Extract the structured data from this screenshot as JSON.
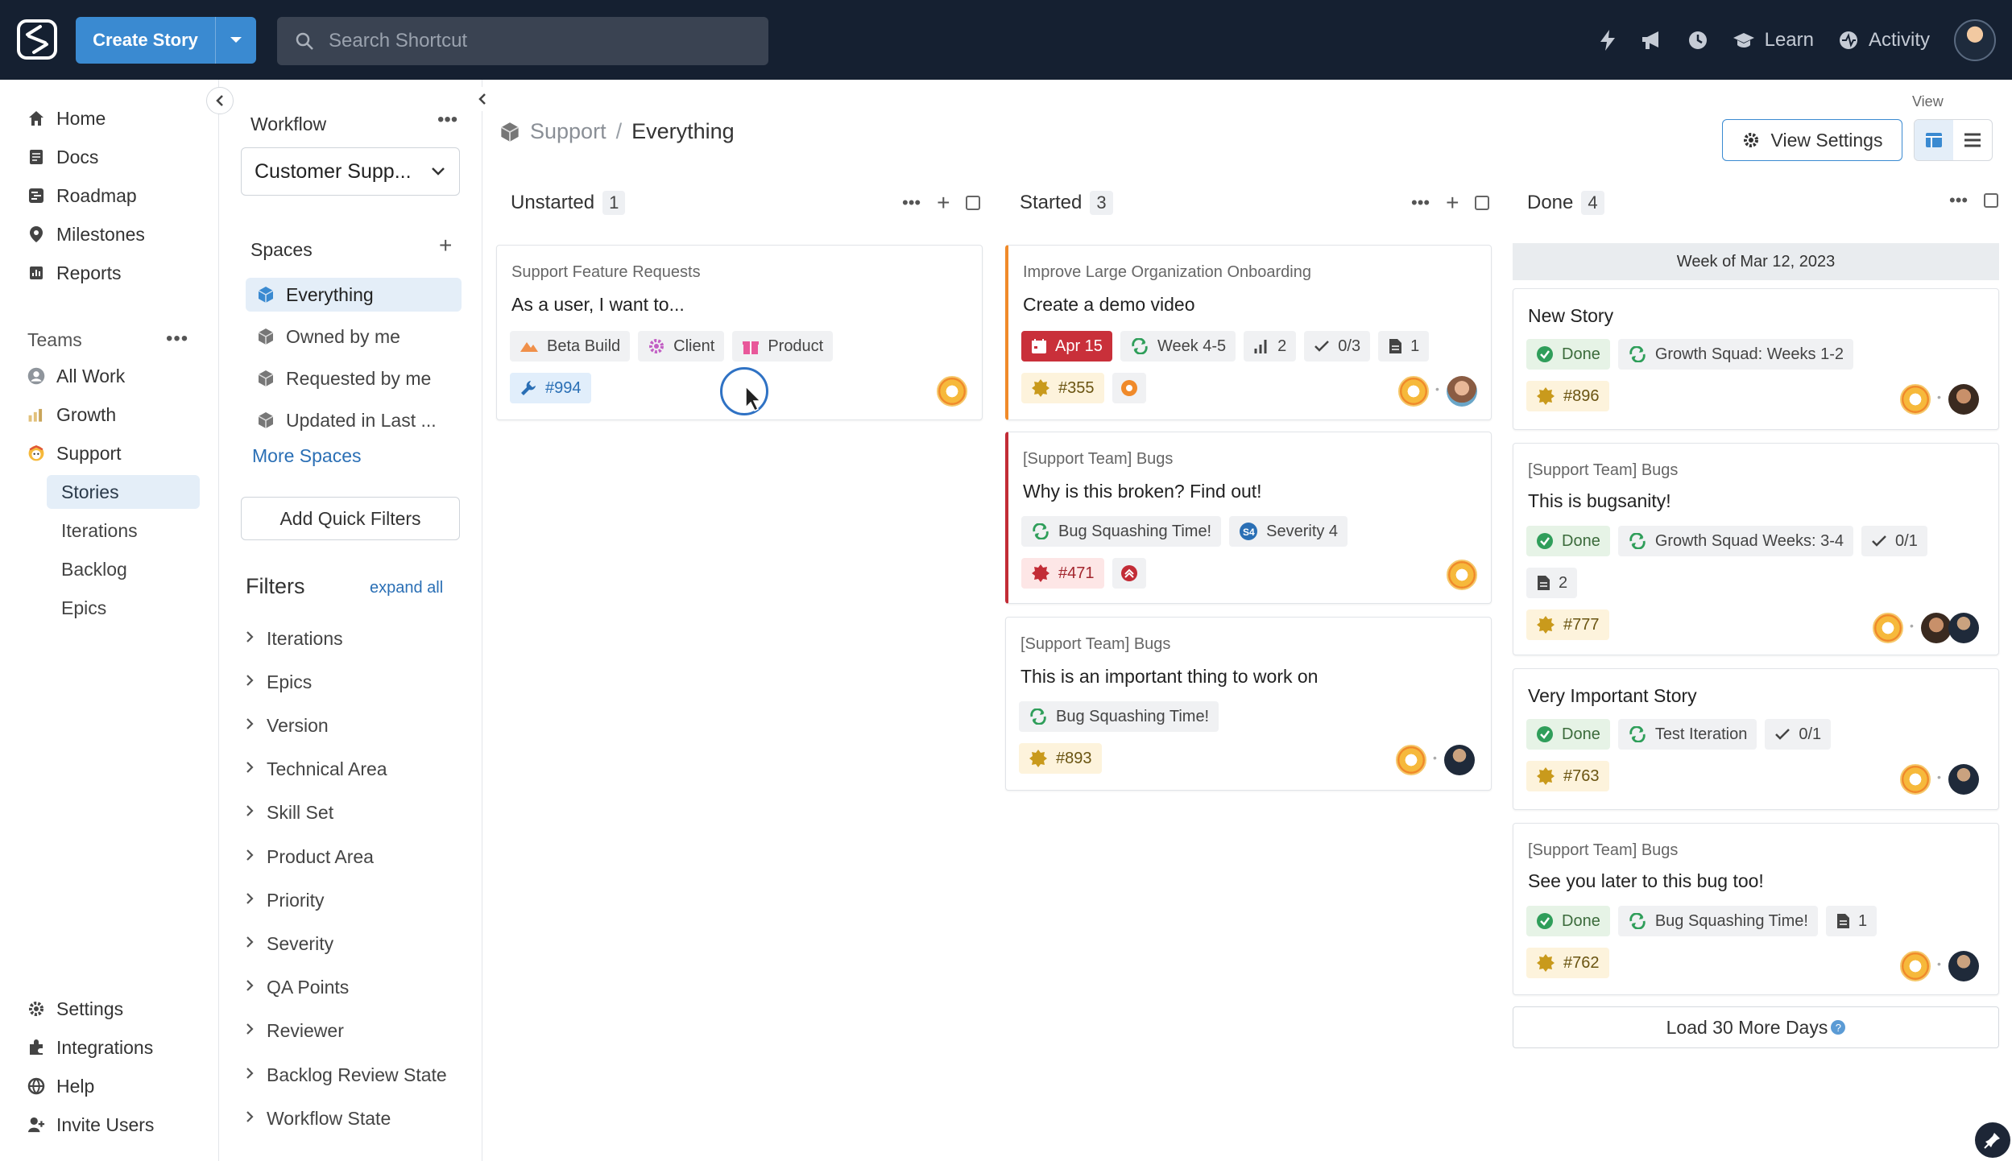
{
  "topbar": {
    "create_label": "Create Story",
    "search_placeholder": "Search Shortcut",
    "learn_label": "Learn",
    "activity_label": "Activity"
  },
  "nav": {
    "items": [
      {
        "label": "Home",
        "icon": "home-icon"
      },
      {
        "label": "Docs",
        "icon": "docs-icon"
      },
      {
        "label": "Roadmap",
        "icon": "roadmap-icon"
      },
      {
        "label": "Milestones",
        "icon": "milestones-icon"
      },
      {
        "label": "Reports",
        "icon": "reports-icon"
      }
    ],
    "teams_label": "Teams",
    "teams": [
      {
        "label": "All Work"
      },
      {
        "label": "Growth"
      },
      {
        "label": "Support"
      }
    ],
    "support_sub": [
      {
        "label": "Stories"
      },
      {
        "label": "Iterations"
      },
      {
        "label": "Backlog"
      },
      {
        "label": "Epics"
      }
    ],
    "bottom": [
      {
        "label": "Settings"
      },
      {
        "label": "Integrations"
      },
      {
        "label": "Help"
      },
      {
        "label": "Invite Users"
      }
    ]
  },
  "panel": {
    "workflow_label": "Workflow",
    "workflow_value": "Customer Supp...",
    "spaces_label": "Spaces",
    "spaces": [
      {
        "label": "Everything"
      },
      {
        "label": "Owned by me"
      },
      {
        "label": "Requested by me"
      },
      {
        "label": "Updated in Last ..."
      }
    ],
    "more_spaces": "More Spaces",
    "add_quick_filters": "Add Quick Filters",
    "filters_label": "Filters",
    "expand_all": "expand all",
    "filters": [
      "Iterations",
      "Epics",
      "Version",
      "Technical Area",
      "Skill Set",
      "Product Area",
      "Priority",
      "Severity",
      "QA Points",
      "Reviewer",
      "Backlog Review State",
      "Workflow State"
    ]
  },
  "main": {
    "breadcrumb_parent": "Support",
    "breadcrumb_sep": "/",
    "breadcrumb_current": "Everything",
    "view_label": "View",
    "view_settings": "View Settings",
    "columns": [
      {
        "name": "Unstarted",
        "count": "1"
      },
      {
        "name": "Started",
        "count": "3"
      },
      {
        "name": "Done",
        "count": "4"
      }
    ],
    "unstarted_cards": [
      {
        "epic": "Support Feature Requests",
        "title": "As a user, I want to...",
        "tags": [
          "Beta Build",
          "Client",
          "Product"
        ],
        "id": "#994"
      }
    ],
    "started_cards": [
      {
        "epic": "Improve Large Organization Onboarding",
        "title": "Create a demo video",
        "date": "Apr 15",
        "iteration": "Week 4-5",
        "estimate": "2",
        "tasks": "0/3",
        "docs": "1",
        "id": "#355"
      },
      {
        "epic": "[Support Team] Bugs",
        "title": "Why is this broken? Find out!",
        "iteration": "Bug Squashing Time!",
        "severity": "Severity 4",
        "id": "#471"
      },
      {
        "epic": "[Support Team] Bugs",
        "title": "This is an important thing to work on",
        "iteration": "Bug Squashing Time!",
        "id": "#893"
      }
    ],
    "week_header": "Week of Mar 12, 2023",
    "done_cards": [
      {
        "title": "New Story",
        "status": "Done",
        "iteration": "Growth Squad: Weeks 1-2",
        "id": "#896"
      },
      {
        "epic": "[Support Team] Bugs",
        "title": "This is bugsanity!",
        "status": "Done",
        "iteration": "Growth Squad Weeks: 3-4",
        "tasks": "0/1",
        "docs": "2",
        "id": "#777"
      },
      {
        "title": "Very Important Story",
        "status": "Done",
        "iteration": "Test Iteration",
        "tasks": "0/1",
        "id": "#763"
      },
      {
        "epic": "[Support Team] Bugs",
        "title": "See you later to this bug too!",
        "status": "Done",
        "iteration": "Bug Squashing Time!",
        "docs": "1",
        "id": "#762"
      }
    ],
    "load_more": "Load 30 More Days",
    "help_glyph": "?"
  }
}
